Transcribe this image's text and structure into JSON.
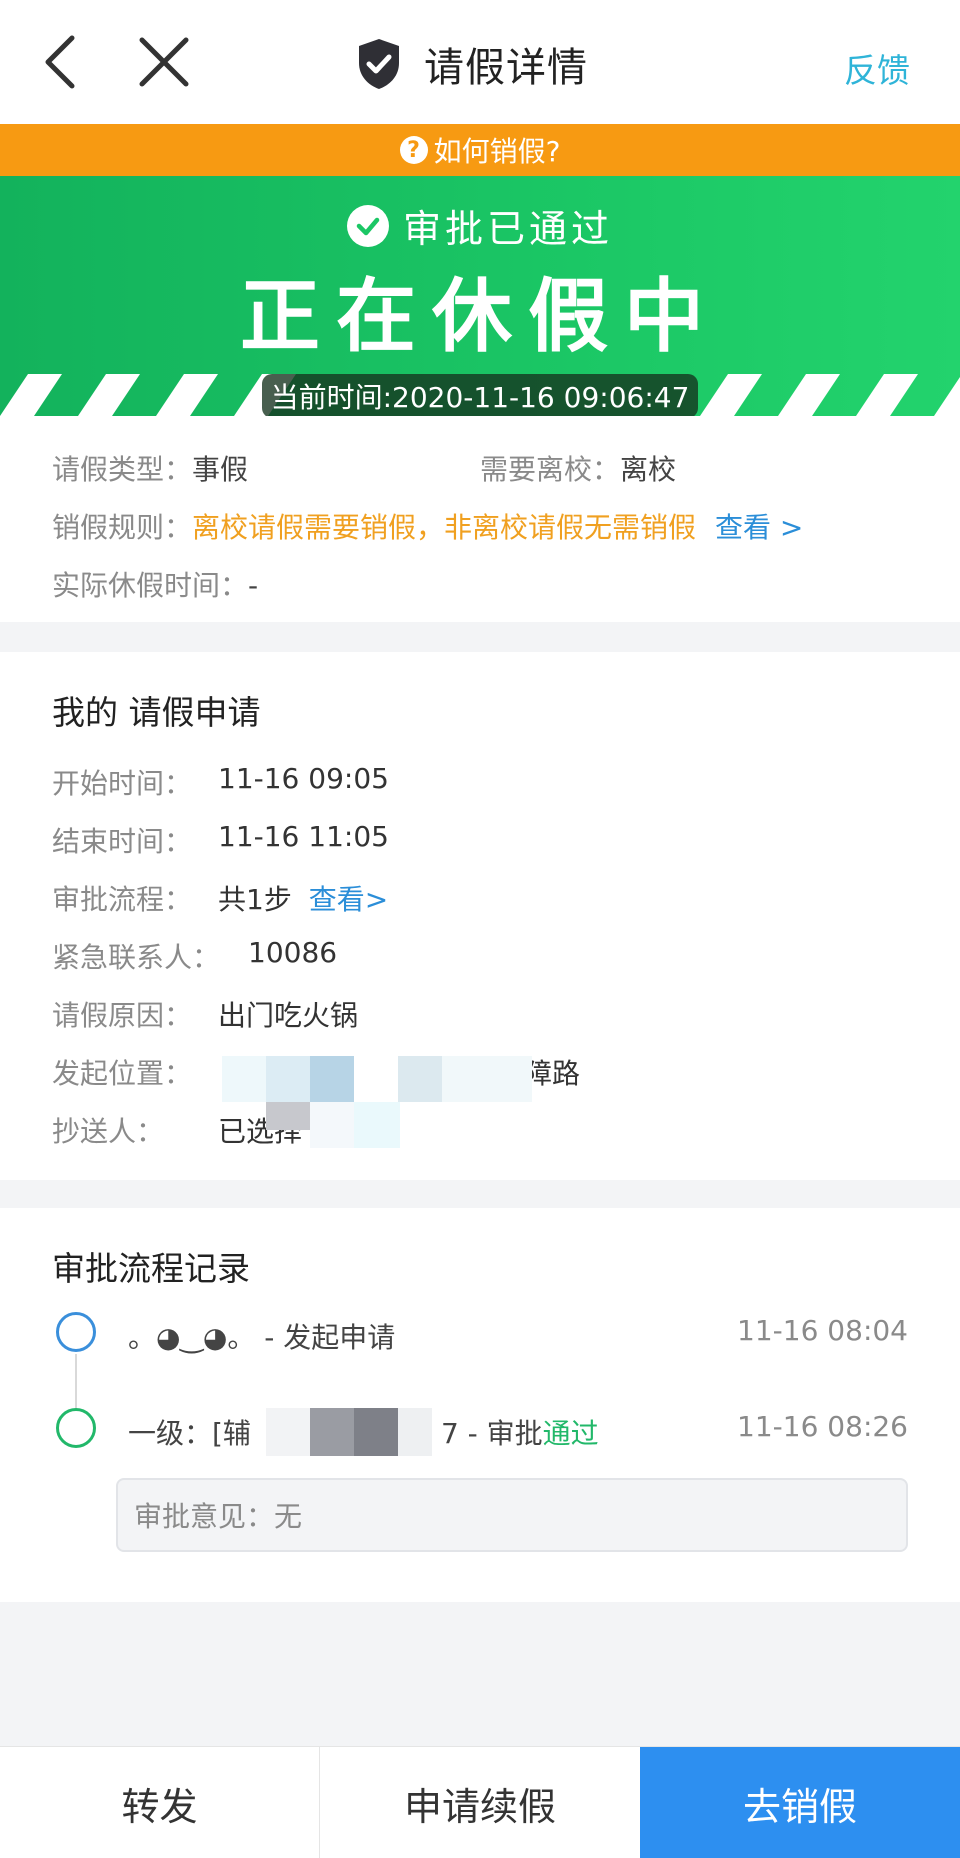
{
  "nav": {
    "title": "请假详情",
    "feedback": "反馈"
  },
  "tip": {
    "text": "如何销假?"
  },
  "banner": {
    "status": "审批已通过",
    "main": "正在休假中",
    "current_time": "当前时间:2020-11-16 09:06:47"
  },
  "info": {
    "type_label": "请假类型：",
    "type_value": "事假",
    "leave_school_label": "需要离校：",
    "leave_school_value": "离校",
    "rule_label": "销假规则：",
    "rule_value": "离校请假需要销假，非离校请假无需销假",
    "rule_link": "查看 >",
    "actual_label": "实际休假时间：",
    "actual_value": "-"
  },
  "application": {
    "title": "我的 请假申请",
    "start_label": "开始时间：",
    "start_value": "11-16 09:05",
    "end_label": "结束时间：",
    "end_value": "11-16 11:05",
    "flow_label": "审批流程：",
    "flow_value": "共1步",
    "flow_link": "查看>",
    "contact_label": "紧急联系人：",
    "contact_value": "10086",
    "reason_label": "请假原因：",
    "reason_value": "出门吃火锅",
    "location_label": "发起位置：",
    "location_tail": "障路",
    "cc_label": "抄送人：",
    "cc_value": "已选择"
  },
  "flow": {
    "title": "审批流程记录",
    "step1_text": "。◕‿◕。 - 发起申请",
    "step1_time": "11-16 08:04",
    "step2_prefix": "一级：[辅",
    "step2_mid": "7 - 审批",
    "step2_status": "通过",
    "step2_time": "11-16 08:26",
    "opinion": "审批意见：无"
  },
  "bottom": {
    "forward": "转发",
    "extend": "申请续假",
    "cancel": "去销假"
  },
  "colors": {
    "green": "#1bc765",
    "orange": "#f79a12",
    "blue": "#2d8ff0",
    "link": "#2fb4d8"
  }
}
